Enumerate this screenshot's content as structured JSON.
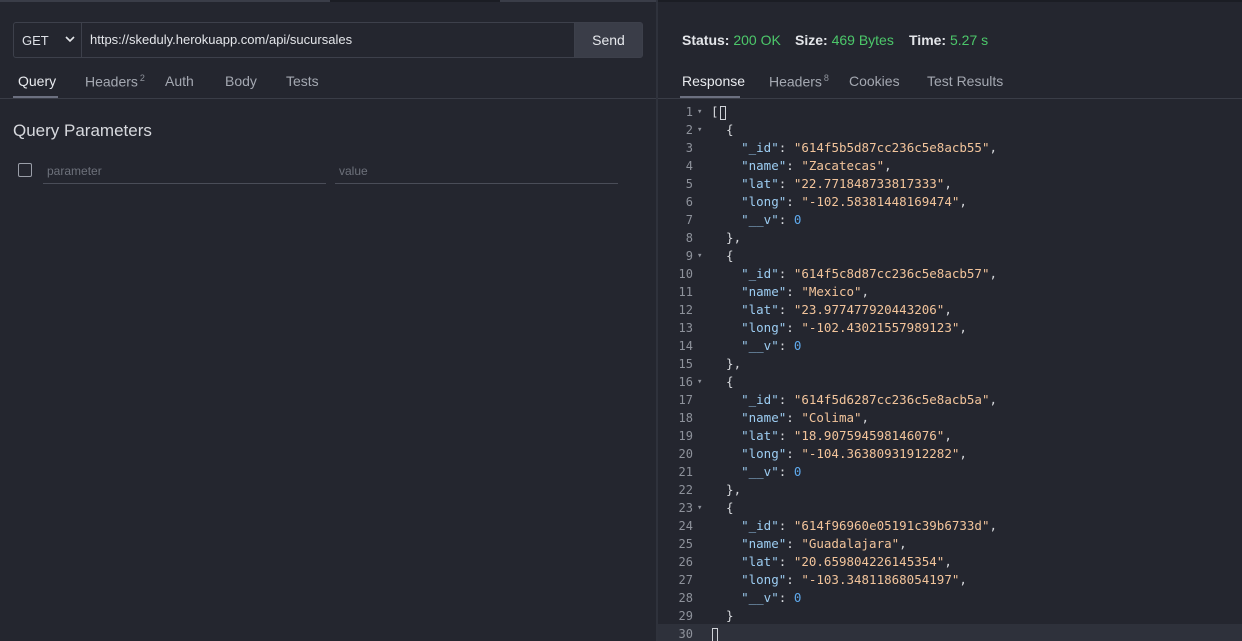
{
  "request": {
    "method": "GET",
    "url": "https://skeduly.herokuapp.com/api/sucursales",
    "send_label": "Send"
  },
  "request_tabs": [
    {
      "label": "Query",
      "badge": "",
      "active": true
    },
    {
      "label": "Headers",
      "badge": "2",
      "active": false
    },
    {
      "label": "Auth",
      "badge": "",
      "active": false
    },
    {
      "label": "Body",
      "badge": "",
      "active": false
    },
    {
      "label": "Tests",
      "badge": "",
      "active": false
    }
  ],
  "query": {
    "title": "Query Parameters",
    "parameter_placeholder": "parameter",
    "value_placeholder": "value"
  },
  "status": {
    "status_label": "Status:",
    "status_value": "200 OK",
    "size_label": "Size:",
    "size_value": "469 Bytes",
    "time_label": "Time:",
    "time_value": "5.27 s"
  },
  "response_tabs": [
    {
      "label": "Response",
      "badge": "",
      "active": true
    },
    {
      "label": "Headers",
      "badge": "8",
      "active": false
    },
    {
      "label": "Cookies",
      "badge": "",
      "active": false
    },
    {
      "label": "Test Results",
      "badge": "",
      "active": false
    }
  ],
  "colors": {
    "background": "#24262f",
    "status_ok": "#4cc76a",
    "json_key": "#9dcdf2",
    "json_string": "#f2c49b",
    "json_number": "#5fa9ec"
  },
  "response_body": [
    {
      "_id": "614f5b5d87cc236c5e8acb55",
      "name": "Zacatecas",
      "lat": "22.771848733817333",
      "long": "-102.58381448169474",
      "__v": 0
    },
    {
      "_id": "614f5c8d87cc236c5e8acb57",
      "name": "Mexico",
      "lat": "23.977477920443206",
      "long": "-102.43021557989123",
      "__v": 0
    },
    {
      "_id": "614f5d6287cc236c5e8acb5a",
      "name": "Colima",
      "lat": "18.907594598146076",
      "long": "-104.36380931912282",
      "__v": 0
    },
    {
      "_id": "614f96960e05191c39b6733d",
      "name": "Guadalajara",
      "lat": "20.659804226145354",
      "long": "-103.34811868054197",
      "__v": 0
    }
  ]
}
